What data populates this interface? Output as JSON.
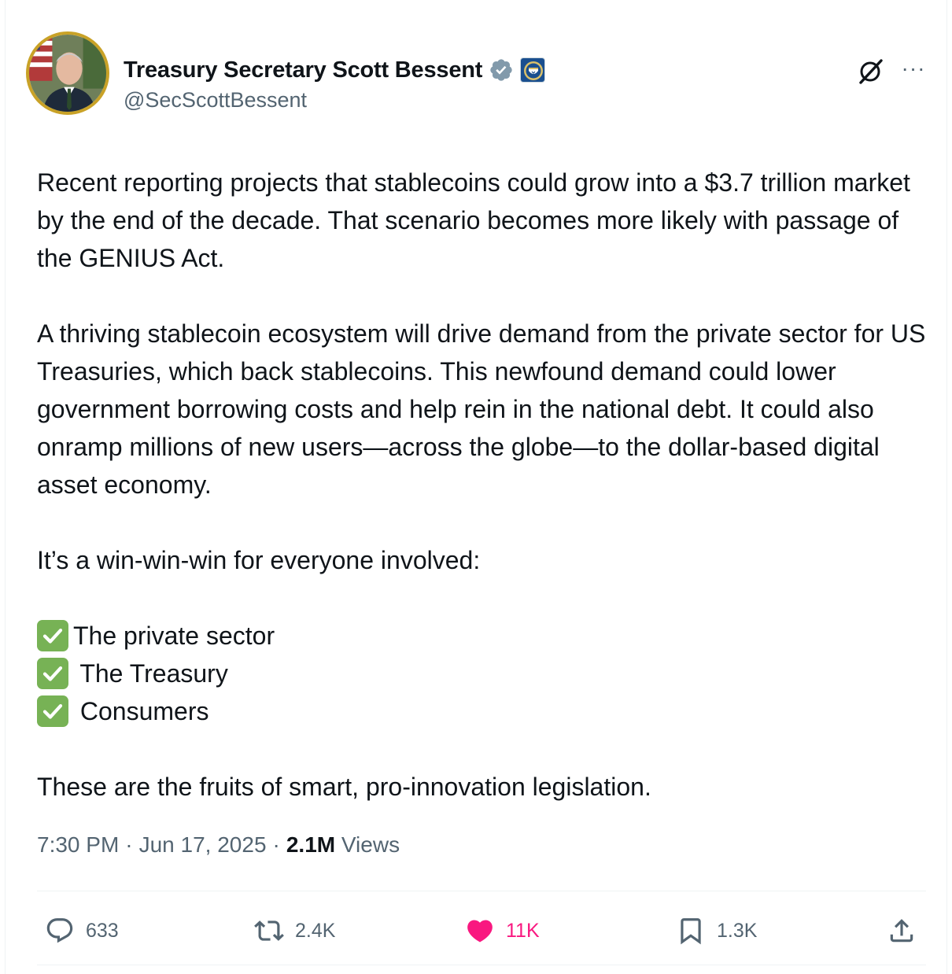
{
  "author": {
    "display_name": "Treasury Secretary Scott Bessent",
    "handle": "@SecScottBessent",
    "verified_badge": "verified-badge-icon",
    "affiliation_badge": "treasury-seal-icon",
    "avatar_ring_color": "#c9a227"
  },
  "header_icons": {
    "grok": "grok-icon",
    "more": "···"
  },
  "tweet": {
    "paragraph_1": "Recent reporting projects that stablecoins could grow into a $3.7 trillion market by the end of the decade. That scenario becomes more likely with passage of the GENIUS Act.",
    "paragraph_2": "A thriving stablecoin ecosystem will drive demand from the private sector for US Treasuries, which back stablecoins. This newfound demand could lower government borrowing costs and help rein in the national debt. It could also onramp millions of new users—across the globe—to the dollar-based digital asset economy.",
    "paragraph_3": "It’s a win-win-win for everyone involved:",
    "checklist": [
      "The private sector",
      " The Treasury",
      " Consumers"
    ],
    "paragraph_4": "These are the fruits of smart, pro-innovation legislation."
  },
  "meta": {
    "time": "7:30 PM",
    "separator": "·",
    "date": "Jun 17, 2025",
    "views_count": "2.1M",
    "views_label": "Views"
  },
  "actions": {
    "replies": "633",
    "reposts": "2.4K",
    "likes": "11K",
    "bookmarks": "1.3K",
    "like_color": "#f91880",
    "check_color": "#77b255"
  }
}
